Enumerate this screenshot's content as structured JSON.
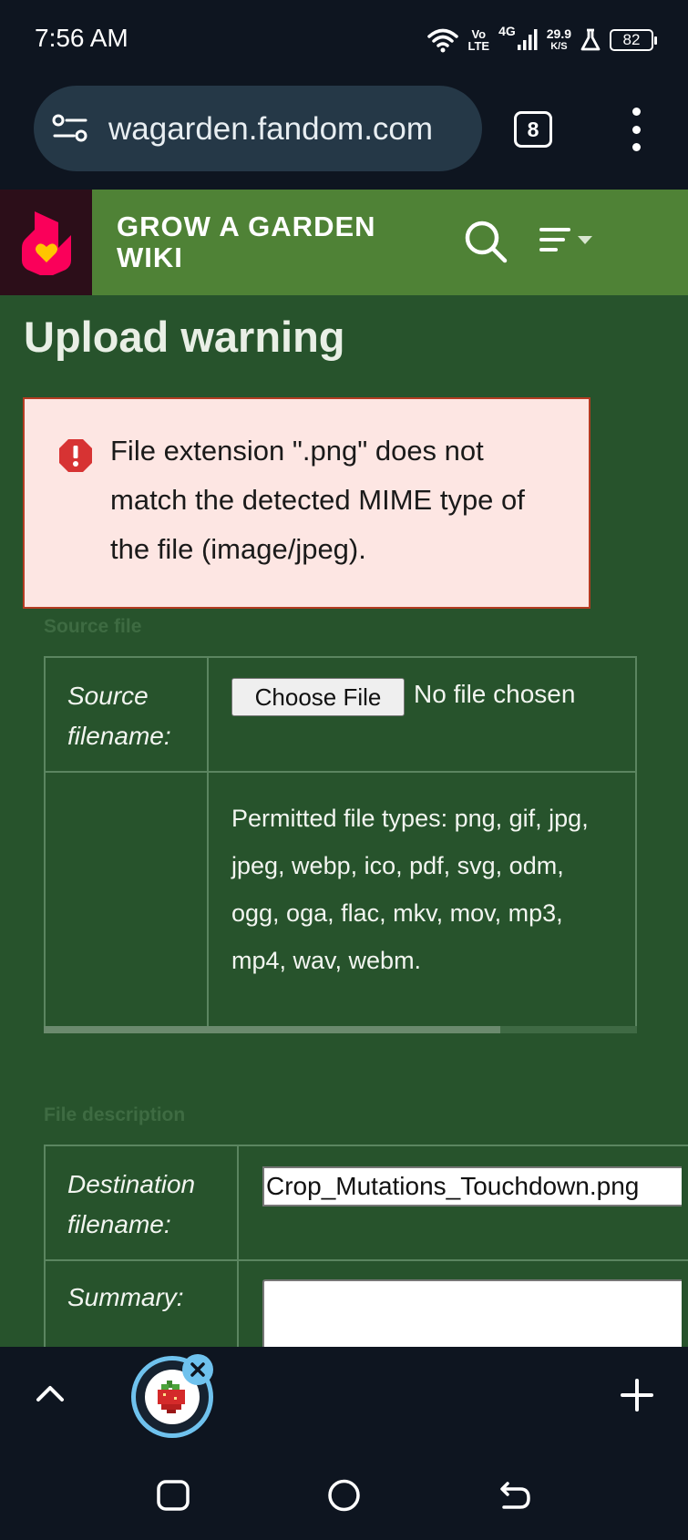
{
  "status_bar": {
    "time": "7:56 AM",
    "volte_top": "Vo",
    "volte_bottom": "LTE",
    "network": "4G",
    "speed_value": "29.9",
    "speed_unit": "K/S",
    "battery": "82"
  },
  "browser": {
    "url": "wagarden.fandom.com",
    "tab_count": "8"
  },
  "wiki": {
    "title": "GROW A GARDEN WIKI",
    "brand_color": "#4f8236"
  },
  "page": {
    "title": "Upload warning",
    "warning_message": "File extension \".png\" does not match the detected MIME type of the file (image/jpeg).",
    "source_section": {
      "legend": "Source file",
      "filename_label": "Source filename:",
      "choose_file_label": "Choose File",
      "no_file_text": "No file chosen",
      "permitted_text": "Permitted file types: png, gif, jpg, jpeg, webp, ico, pdf, svg, odm, ogg, oga, flac, mkv, mov, mp3, mp4, wav, webm."
    },
    "description_section": {
      "legend": "File description",
      "destination_label": "Destination filename:",
      "destination_value": "Crop_Mutations_Touchdown.png",
      "summary_label": "Summary:",
      "summary_value": ""
    }
  },
  "toolbar": {
    "icons": [
      "chevron-up-icon",
      "tab-favicon",
      "close-icon",
      "plus-icon"
    ]
  },
  "nav": {
    "icons": [
      "recents-icon",
      "home-icon",
      "back-icon"
    ]
  }
}
